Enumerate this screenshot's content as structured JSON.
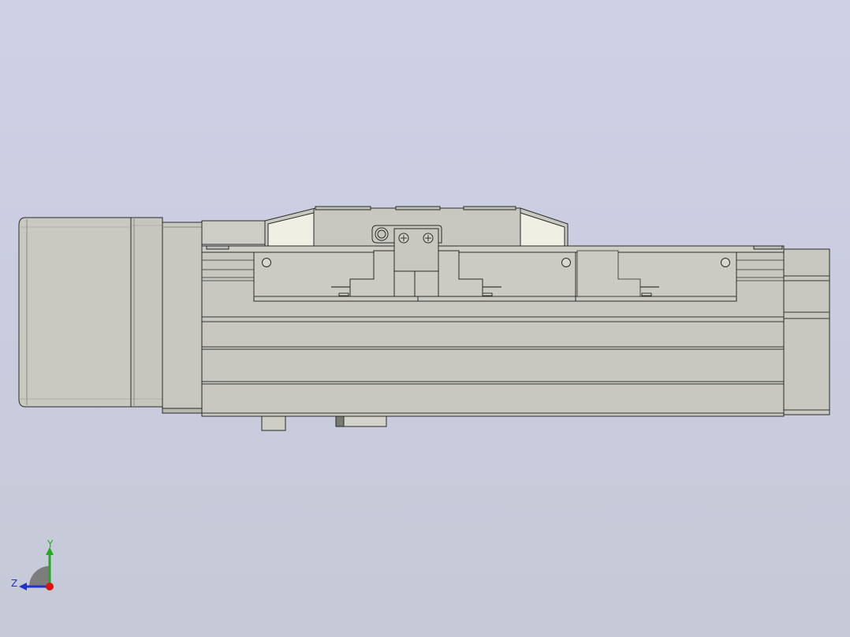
{
  "viewport": {
    "background_top": "#cfd0e6",
    "background_bottom": "#c6c9d6"
  },
  "model": {
    "body_color": "#c8c8c0",
    "body_light": "#d4d4cc",
    "edge_color": "#2a2a2a",
    "highlight_color": "#efefe4"
  },
  "triad": {
    "y_label": "Y",
    "z_label": "Z",
    "y_color": "#22aa22",
    "z_color": "#2233cc",
    "x_color": "#dd1111"
  }
}
